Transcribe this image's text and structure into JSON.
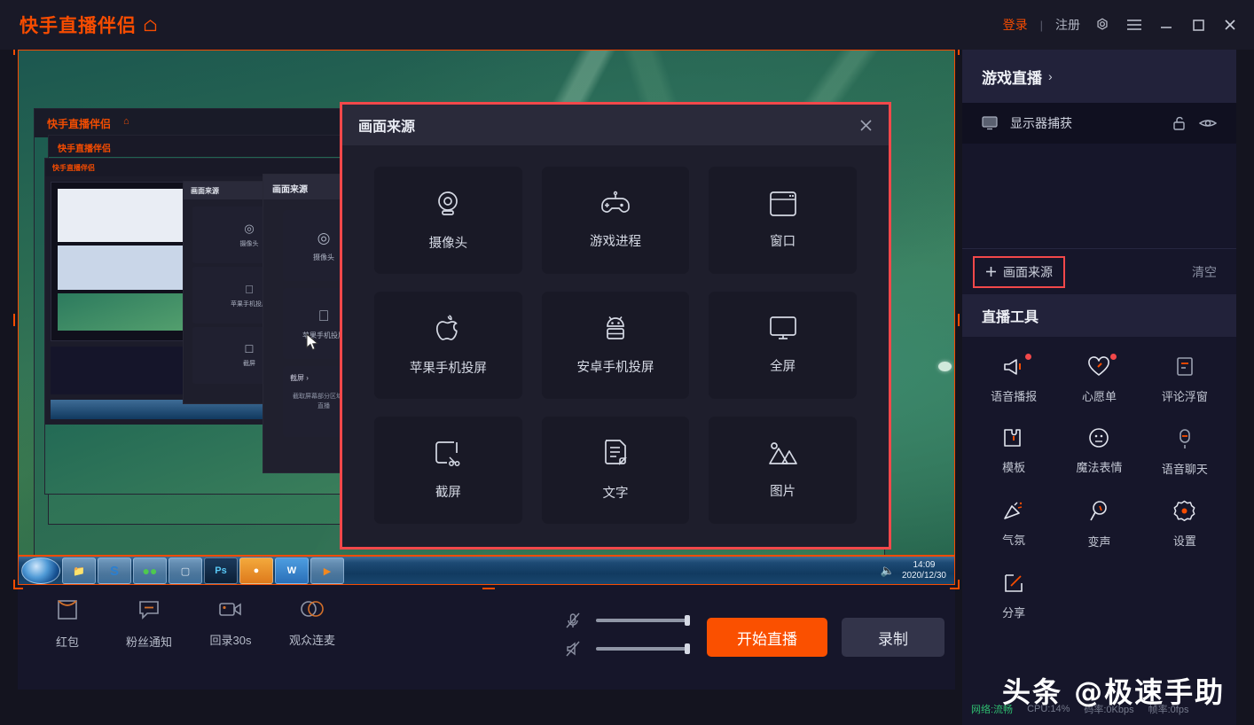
{
  "titlebar": {
    "brand": "快手直播伴侣",
    "home_icon": "home-icon",
    "login": "登录",
    "separator": "|",
    "register": "注册",
    "settings_icon": "gear-icon",
    "menu_icon": "hamburger-icon",
    "minimize_icon": "minimize-icon",
    "maximize_icon": "maximize-icon",
    "close_icon": "close-icon"
  },
  "preview": {
    "windows_taskbar": {
      "apps": [
        "start-orb",
        "explorer",
        "sogou",
        "wechat",
        "notepad",
        "photoshop",
        "browser",
        "wps",
        "media-player"
      ],
      "time": "14:09",
      "date": "2020/12/30"
    },
    "nested_window": {
      "brand": "快手直播伴侣",
      "dialog_title": "画面来源",
      "tiles": [
        "摄像头",
        "苹果手机投屏",
        "截屏"
      ],
      "hover_item": "截屏",
      "hover_desc": "截取屏幕部分区域进行直播"
    }
  },
  "modal": {
    "title": "画面来源",
    "close_icon": "close-icon",
    "sources": [
      {
        "label": "摄像头",
        "icon": "webcam-icon"
      },
      {
        "label": "游戏进程",
        "icon": "gamepad-icon"
      },
      {
        "label": "窗口",
        "icon": "window-icon"
      },
      {
        "label": "苹果手机投屏",
        "icon": "apple-icon"
      },
      {
        "label": "安卓手机投屏",
        "icon": "android-icon"
      },
      {
        "label": "全屏",
        "icon": "monitor-icon"
      },
      {
        "label": "截屏",
        "icon": "crop-icon"
      },
      {
        "label": "文字",
        "icon": "text-doc-icon"
      },
      {
        "label": "图片",
        "icon": "image-icon"
      }
    ]
  },
  "bottombar": {
    "tools": [
      {
        "label": "红包",
        "icon": "red-envelope-icon"
      },
      {
        "label": "粉丝通知",
        "icon": "fan-notice-icon"
      },
      {
        "label": "回录30s",
        "icon": "replay-icon"
      },
      {
        "label": "观众连麦",
        "icon": "co-host-icon"
      }
    ],
    "mic_icon": "mic-muted-icon",
    "speaker_icon": "speaker-muted-icon",
    "mic_value": 100,
    "speaker_value": 100,
    "start_live": "开始直播",
    "record": "录制"
  },
  "right_panel": {
    "scene_header": "游戏直播",
    "scene_chevron": "chevron-right-icon",
    "sources": [
      {
        "name": "显示器捕获",
        "icon": "monitor-icon",
        "lock_icon": "unlock-icon",
        "eye_icon": "eye-icon"
      }
    ],
    "add_source": "画面来源",
    "add_icon": "plus-icon",
    "clear": "清空",
    "tools_header": "直播工具",
    "tools": [
      {
        "label": "语音播报",
        "icon": "megaphone-icon",
        "badge": true
      },
      {
        "label": "心愿单",
        "icon": "heart-icon",
        "badge": true
      },
      {
        "label": "评论浮窗",
        "icon": "comment-float-icon",
        "badge": false
      },
      {
        "label": "模板",
        "icon": "template-icon",
        "badge": false
      },
      {
        "label": "魔法表情",
        "icon": "magic-emoji-icon",
        "badge": false
      },
      {
        "label": "语音聊天",
        "icon": "voice-chat-icon",
        "badge": false
      },
      {
        "label": "气氛",
        "icon": "confetti-icon",
        "badge": false
      },
      {
        "label": "变声",
        "icon": "voice-changer-icon",
        "badge": false
      },
      {
        "label": "设置",
        "icon": "gear-icon",
        "badge": false
      },
      {
        "label": "分享",
        "icon": "share-icon",
        "badge": false
      }
    ],
    "status": {
      "network": "网络:流畅",
      "cpu": "CPU:14%",
      "bitrate": "码率:0Kbps",
      "fps": "帧率:0fps"
    }
  },
  "watermark": "头条 @极速手助",
  "colors": {
    "accent": "#f74c00",
    "highlight": "#f2484a",
    "panel": "#16162a",
    "network_ok": "#2fbf71"
  }
}
